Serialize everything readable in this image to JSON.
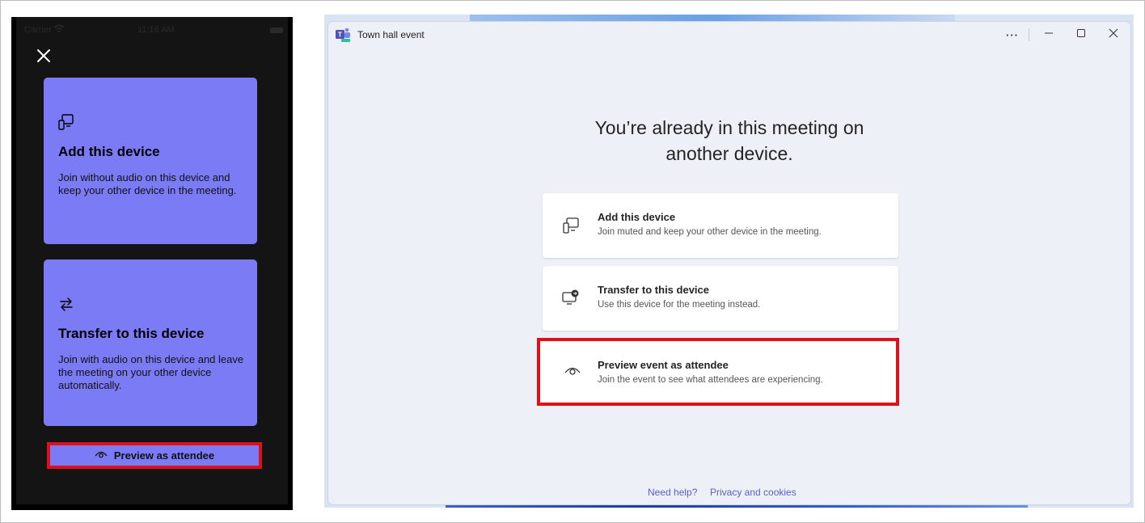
{
  "phone": {
    "status": {
      "carrier": "Carrier",
      "time": "11:16 AM"
    },
    "close_icon": "close-icon",
    "cards": [
      {
        "icon": "add-device-icon",
        "title": "Add this device",
        "description": "Join without audio on this device and keep your other device in the meeting."
      },
      {
        "icon": "transfer-arrows-icon",
        "title": "Transfer to this device",
        "description": "Join with audio on this device and leave the meeting on your other device automatically."
      }
    ],
    "preview_button": {
      "icon": "eye-icon",
      "label": "Preview as attendee"
    },
    "colors": {
      "card": "#7b7bf5",
      "background": "#141414",
      "highlight": "#e0101a"
    }
  },
  "window": {
    "title": "Town hall event",
    "controls": {
      "more": "···",
      "minimize": "minimize",
      "maximize": "maximize",
      "close": "close"
    },
    "heading_line1": "You’re already in this meeting on",
    "heading_line2": "another device.",
    "options": [
      {
        "icon": "add-device-icon",
        "title": "Add this device",
        "description": "Join muted and keep your other device in the meeting."
      },
      {
        "icon": "transfer-device-icon",
        "title": "Transfer to this device",
        "description": "Use this device for the meeting instead."
      },
      {
        "icon": "eye-icon",
        "title": "Preview event as attendee",
        "description": "Join the event to see what attendees are experiencing."
      }
    ],
    "footer": {
      "help": "Need help?",
      "privacy": "Privacy and cookies"
    },
    "colors": {
      "accent": "#5b5fc7",
      "highlight": "#e0101a",
      "window_bg": "#edf1f7"
    }
  }
}
